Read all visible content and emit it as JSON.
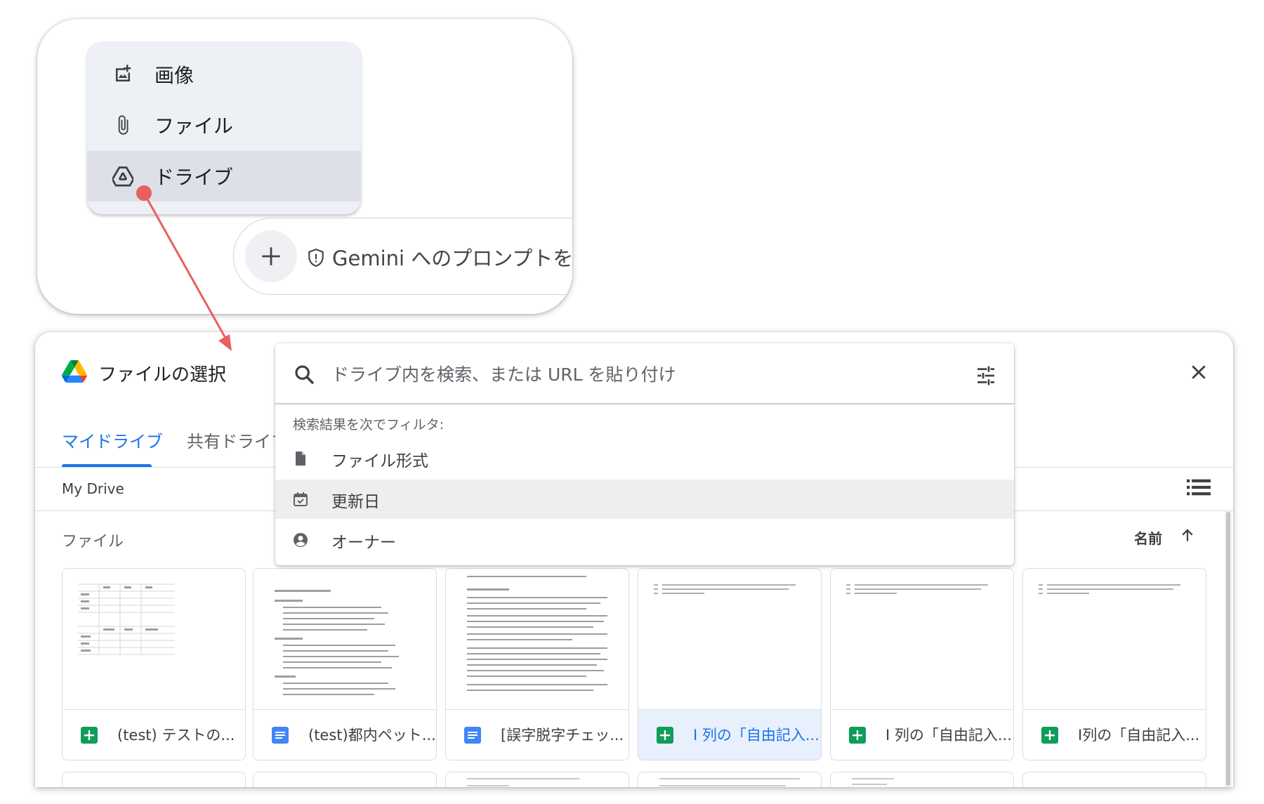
{
  "attach_menu": {
    "items": [
      {
        "label": "画像",
        "icon": "add-image-icon"
      },
      {
        "label": "ファイル",
        "icon": "paperclip-icon"
      },
      {
        "label": "ドライブ",
        "icon": "drive-icon",
        "highlighted": true
      }
    ]
  },
  "prompt_bar": {
    "placeholder": "Gemini へのプロンプトを入"
  },
  "annotation": {
    "arrow_color": "#e8605f"
  },
  "picker": {
    "title": "ファイルの選択",
    "tabs": [
      {
        "label": "マイドライブ",
        "active": true
      },
      {
        "label": "共有ドライブ",
        "active": false
      }
    ],
    "breadcrumb": "My Drive",
    "section_label": "ファイル",
    "sort_label": "名前",
    "files": [
      {
        "name": "(test) テストの...",
        "type": "sheets"
      },
      {
        "name": "(test)都内ペット...",
        "type": "docs"
      },
      {
        "name": "[誤字脱字チェッ...",
        "type": "docs"
      },
      {
        "name": "I 列の「自由記入...",
        "type": "sheets",
        "selected": true
      },
      {
        "name": "I 列の「自由記入...",
        "type": "sheets"
      },
      {
        "name": "I列の「自由記入...",
        "type": "sheets"
      }
    ]
  },
  "search": {
    "placeholder": "ドライブ内を検索、または URL を貼り付け",
    "filter_heading": "検索結果を次でフィルタ:",
    "filters": [
      {
        "label": "ファイル形式",
        "icon": "file-icon"
      },
      {
        "label": "更新日",
        "icon": "calendar-check-icon",
        "hovered": true
      },
      {
        "label": "オーナー",
        "icon": "account-circle-icon"
      }
    ]
  },
  "colors": {
    "accent": "#1a73e8",
    "sheets_green": "#0f9d58",
    "docs_blue": "#4285f4"
  }
}
